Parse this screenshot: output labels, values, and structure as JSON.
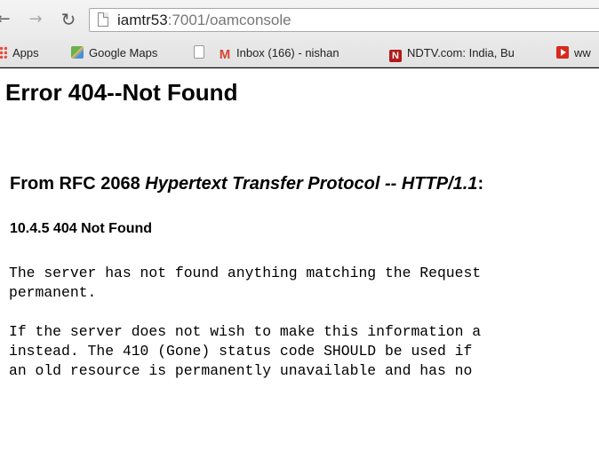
{
  "browser": {
    "url_host": "iamtr53",
    "url_port_path": ":7001/oamconsole",
    "bookmarks": [
      {
        "icon": "apps-grid-icon",
        "label": "Apps"
      },
      {
        "icon": "google-maps-icon",
        "label": "Google Maps"
      },
      {
        "icon": "blank-page-icon",
        "label": ""
      },
      {
        "icon": "gmail-icon",
        "label": "Inbox (166) - nishan"
      },
      {
        "icon": "ndtv-icon",
        "label": "NDTV.com: India, Bu"
      },
      {
        "icon": "youtube-icon",
        "label": "ww"
      }
    ]
  },
  "page": {
    "heading": "Error 404--Not Found",
    "rfc_prefix": "From RFC 2068 ",
    "rfc_title": "Hypertext Transfer Protocol -- HTTP/1.1",
    "rfc_suffix": ":",
    "section": "10.4.5 404 Not Found",
    "para1_line1": "The server has not found anything matching the Request",
    "para1_line2": "permanent.",
    "para2_line1": "If the server does not wish to make this information a",
    "para2_line2": "instead. The 410 (Gone) status code SHOULD be used if",
    "para2_line3": "an old resource is permanently unavailable and has no"
  }
}
